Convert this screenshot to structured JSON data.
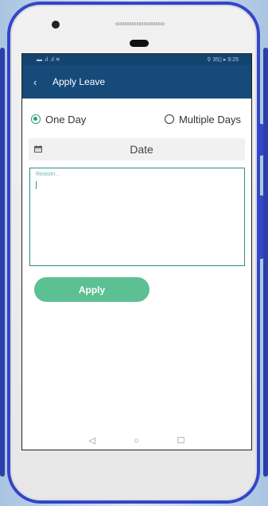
{
  "status_bar": {
    "left": "▬ .ıl .ıl ≋",
    "right": "⚲ 35▯ ▸ 9:25"
  },
  "app_bar": {
    "back_icon": "‹",
    "title": "Apply Leave"
  },
  "leave_type": {
    "options": [
      "One Day",
      "Multiple Days"
    ],
    "selected": "One Day"
  },
  "date": {
    "label": "Date",
    "icon": "calendar-icon"
  },
  "reason": {
    "placeholder": "Reason...",
    "value": ""
  },
  "apply_button": {
    "label": "Apply"
  },
  "nav": {
    "back": "◁",
    "home": "○",
    "recents": "☐"
  },
  "colors": {
    "app_bar": "#154a79",
    "accent": "#2a9d7a",
    "button": "#5cc092",
    "phone_frame": "#3345c9"
  }
}
